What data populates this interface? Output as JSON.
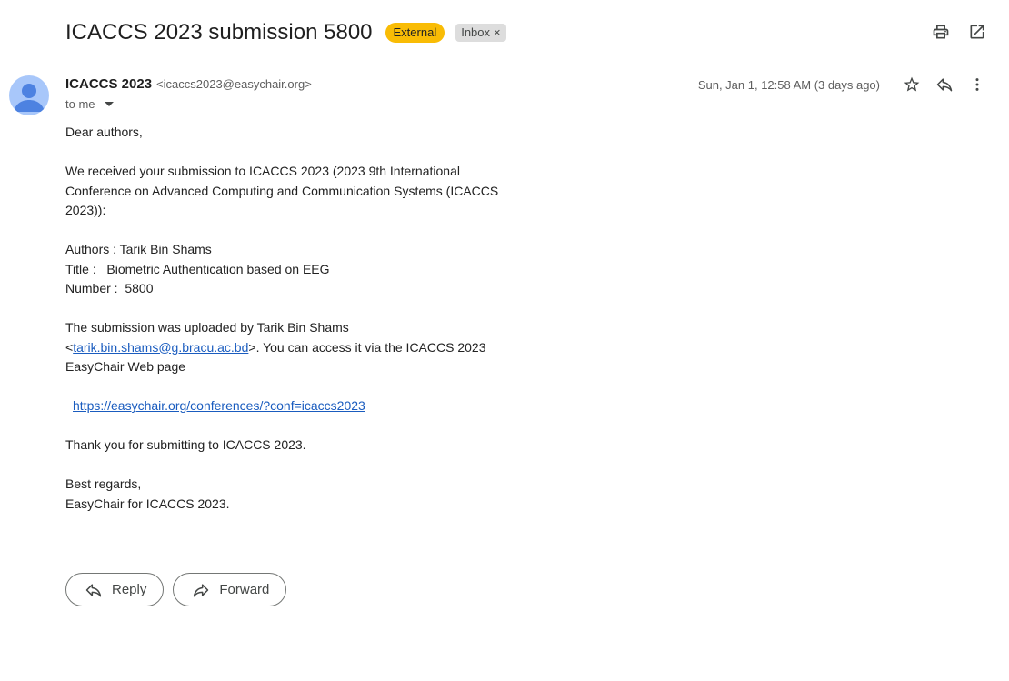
{
  "header": {
    "subject": "ICACCS 2023 submission 5800",
    "label_external": "External",
    "label_inbox": "Inbox",
    "label_inbox_remove": "×"
  },
  "message": {
    "sender_name": "ICACCS 2023",
    "sender_email": "<icaccs2023@easychair.org>",
    "to": "to me",
    "date": "Sun, Jan 1, 12:58 AM (3 days ago)"
  },
  "body": {
    "greeting": "Dear authors,",
    "intro": "We received your submission to ICACCS 2023 (2023 9th International Conference on Advanced Computing and Communication Systems (ICACCS 2023)):",
    "authors": "Authors : Tarik Bin Shams",
    "title": "Title :   Biometric Authentication based on EEG",
    "number": "Number :  5800",
    "uploaded_prefix": "The submission was uploaded by Tarik Bin Shams <",
    "uploader_email": "tarik.bin.shams@g.bracu.ac.bd",
    "uploaded_suffix": ">. You can access it via the ICACCS 2023 EasyChair Web page",
    "link": "https://easychair.org/conferences/?conf=icaccs2023",
    "thanks": "Thank you for submitting to ICACCS 2023.",
    "regards": "Best regards,",
    "signature": "EasyChair for ICACCS 2023."
  },
  "actions": {
    "reply": "Reply",
    "forward": "Forward"
  },
  "colors": {
    "external_chip": "#f9bc05",
    "inbox_chip": "#dddddd",
    "link": "#1a5cbf",
    "avatar_bg": "#a8c7fa",
    "avatar_fg": "#4d82e1"
  },
  "icons": {
    "print": "print-icon",
    "open_new_window": "open-in-new-window-icon",
    "star": "star-icon",
    "reply": "reply-icon",
    "more": "more-vert-icon",
    "forward": "forward-icon",
    "avatar": "person-avatar-icon"
  }
}
